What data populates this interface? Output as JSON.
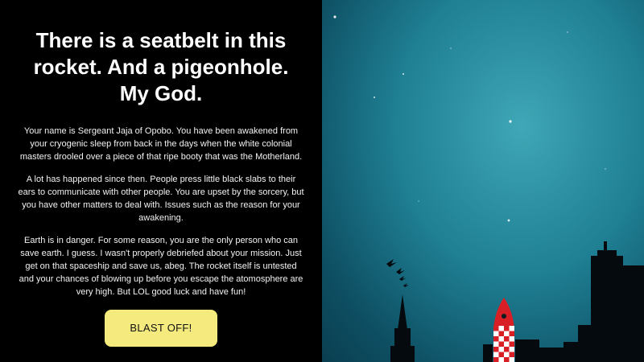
{
  "story": {
    "title": "There is a seatbelt in this rocket. And a pigeonhole. My God.",
    "paragraphs": [
      "Your name is Sergeant Jaja of Opobo. You have been awakened from your cryogenic sleep from back in the days when the white colonial masters drooled over a piece of that ripe booty that was the Motherland.",
      "A lot has happened since then. People press little black slabs to their ears to communicate with other people. You are upset by the sorcery, but you have other matters to deal with. Issues such as the reason for your awakening.",
      "Earth is in danger. For some reason, you are the only person who can save earth. I guess. I wasn't properly debriefed about your mission. Just get on that spaceship and save us, abeg. The rocket itself is untested and your chances of blowing up before you escape the atomosphere are very high. But LOL good luck and have fun!"
    ],
    "button_label": "BLAST OFF!"
  },
  "colors": {
    "panel_bg": "#000000",
    "button_bg": "#f4ea7e",
    "sky_center": "#3fa7b7",
    "sky_edge": "#0a3e50",
    "rocket_red": "#d81f26"
  },
  "scene": {
    "elements": [
      "stars",
      "birds",
      "church-spire",
      "rocket",
      "city-skyline"
    ]
  }
}
